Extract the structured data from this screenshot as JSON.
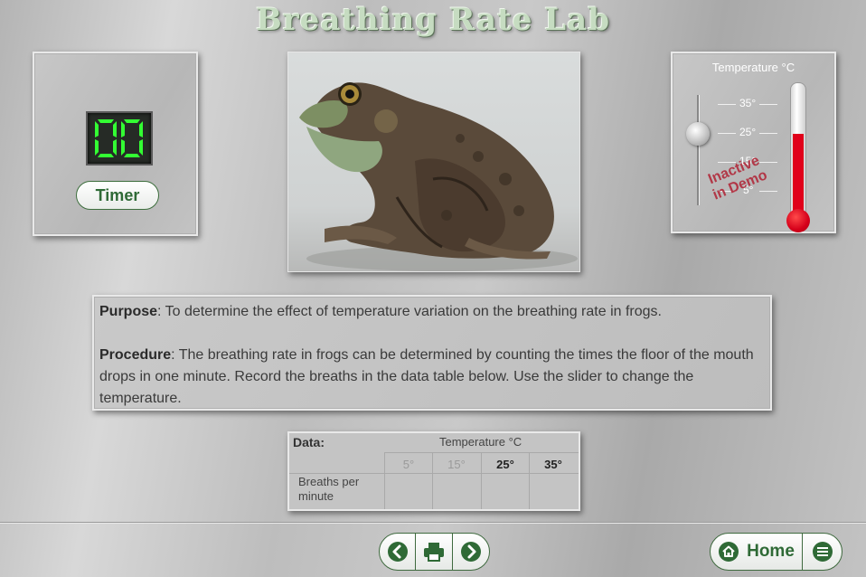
{
  "app": {
    "title": "Breathing Rate Lab"
  },
  "timer": {
    "display": "00",
    "button_label": "Timer"
  },
  "temperature": {
    "label": "Temperature °C",
    "scale": [
      "35°",
      "25°",
      "15°",
      "5°"
    ],
    "demo_stamp_line1": "Inactive",
    "demo_stamp_line2": "in Demo",
    "slider_value": "25°",
    "thermometer_fill_fraction": 0.67
  },
  "photo": {
    "subject": "frog-photo"
  },
  "purpose": {
    "purpose_label": "Purpose",
    "purpose_text": ": To determine the effect of temperature variation on the breathing rate in frogs.",
    "procedure_label": "Procedure",
    "procedure_text": ": The breathing rate in frogs can be determined by counting the times the floor of the mouth drops in one minute. Record the breaths in the data table below. Use the slider to change the temperature."
  },
  "data_table": {
    "title": "Data:",
    "header": "Temperature °C",
    "columns": [
      "5°",
      "15°",
      "25°",
      "35°"
    ],
    "row_label": "Breaths per minute",
    "values": [
      "",
      "",
      "",
      ""
    ]
  },
  "nav": {
    "back_icon": "chevron-left-icon",
    "print_icon": "printer-icon",
    "forward_icon": "chevron-right-icon",
    "home_label": "Home",
    "menu_icon": "menu-icon"
  },
  "colors": {
    "accent_green": "#2f6a36",
    "lcd_green": "#33ff33",
    "mercury_red": "#e0001a"
  }
}
